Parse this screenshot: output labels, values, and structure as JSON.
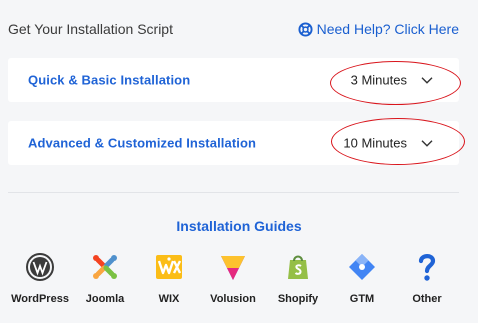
{
  "header": {
    "title": "Get Your Installation Script",
    "help_link": "Need Help? Click Here"
  },
  "options": [
    {
      "label": "Quick & Basic Installation",
      "duration": "3 Minutes"
    },
    {
      "label": "Advanced & Customized Installation",
      "duration": "10 Minutes"
    }
  ],
  "guides": {
    "title": "Installation Guides",
    "items": [
      {
        "label": "WordPress",
        "icon": "wordpress-icon"
      },
      {
        "label": "Joomla",
        "icon": "joomla-icon"
      },
      {
        "label": "WIX",
        "icon": "wix-icon"
      },
      {
        "label": "Volusion",
        "icon": "volusion-icon"
      },
      {
        "label": "Shopify",
        "icon": "shopify-icon"
      },
      {
        "label": "GTM",
        "icon": "gtm-icon"
      },
      {
        "label": "Other",
        "icon": "question-icon"
      }
    ]
  },
  "colors": {
    "accent": "#1f63d6",
    "highlight": "#d9151c",
    "background": "#f5f6f8"
  }
}
